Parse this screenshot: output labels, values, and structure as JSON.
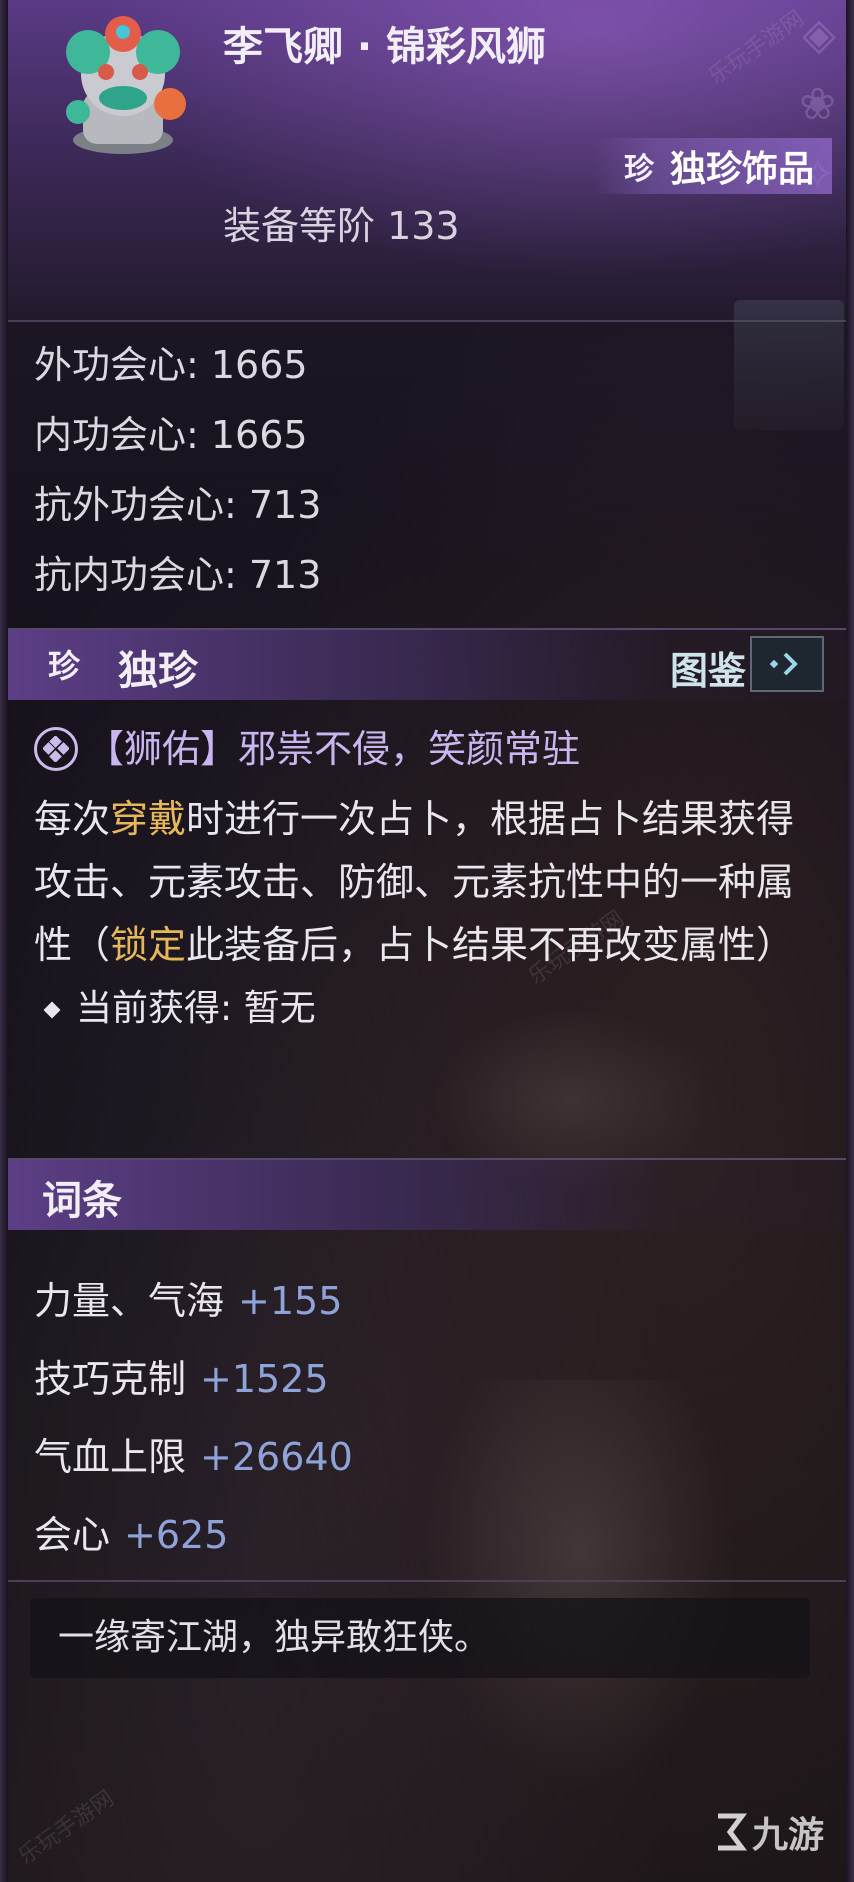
{
  "item": {
    "name": "李飞卿 · 锦彩风狮",
    "rarity_badge": "珍",
    "rarity": "独珍饰品",
    "equip_level": "装备等阶 133"
  },
  "stats": [
    "外功会心: 1665",
    "内功会心: 1665",
    "抗外功会心: 713",
    "抗内功会心: 713"
  ],
  "unique_section": {
    "icon": "珍",
    "title": "独珍",
    "tujian_label": "图鉴",
    "effect_name": "【狮佑】邪祟不侵，笑颜常驻",
    "desc_part1": "每次",
    "desc_hl1": "穿戴",
    "desc_part2": "时进行一次占卜，根据占卜结果获得攻击、元素攻击、防御、元素抗性中的一种属性（",
    "desc_hl2": "锁定",
    "desc_part3": "此装备后，占卜结果不再改变属性）",
    "current": "当前获得: 暂无"
  },
  "affix_section": {
    "title": "词条",
    "items": [
      {
        "name": "力量、气海",
        "value": "+155"
      },
      {
        "name": "技巧克制",
        "value": "+1525"
      },
      {
        "name": "气血上限",
        "value": "+26640"
      },
      {
        "name": "会心",
        "value": "+625"
      }
    ]
  },
  "flavor_text": "一缘寄江湖，独异敢狂侠。",
  "watermark": "乐玩手游网",
  "logo": "九游",
  "colors": {
    "highlight": "#e6b75a",
    "affix_value": "#8fa3d9",
    "effect_title": "#c9b6ef"
  }
}
